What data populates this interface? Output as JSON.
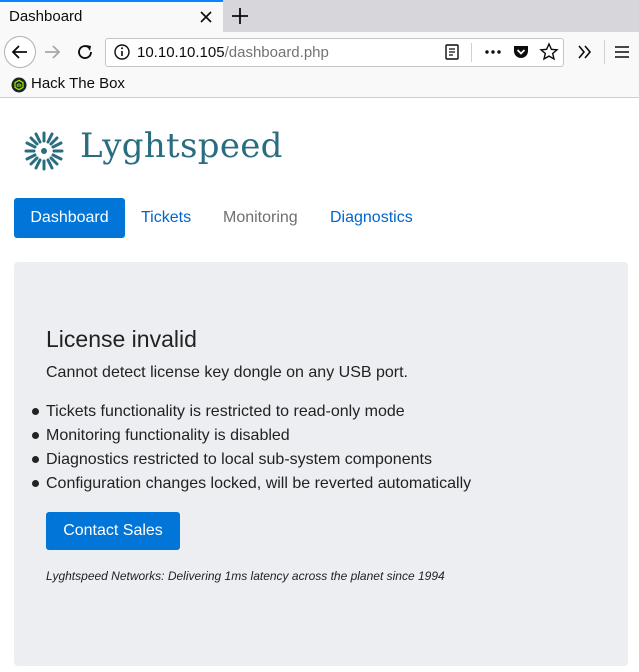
{
  "browser": {
    "tab_title": "Dashboard",
    "url_host": "10.10.10.105",
    "url_path": "/dashboard.php",
    "bookmark_label": "Hack The Box"
  },
  "site": {
    "brand": "Lyghtspeed",
    "nav": [
      {
        "label": "Dashboard",
        "active": true
      },
      {
        "label": "Tickets"
      },
      {
        "label": "Monitoring"
      },
      {
        "label": "Diagnostics"
      }
    ]
  },
  "notice": {
    "title": "License invalid",
    "lead": "Cannot detect license key dongle on any USB port.",
    "items": [
      "Tickets functionality is restricted to read-only mode",
      "Monitoring functionality is disabled",
      "Diagnostics restricted to local sub-system components",
      "Configuration changes locked, will be reverted automatically"
    ],
    "button": "Contact Sales",
    "footer": "Lyghtspeed Networks: Delivering 1ms latency across the planet since 1994"
  },
  "colors": {
    "accent": "#0275d8",
    "brand": "#2a6d80",
    "panel": "#eceef1"
  },
  "icons": [
    "close-icon",
    "plus-icon",
    "back-arrow-icon",
    "forward-arrow-icon",
    "reload-icon",
    "info-icon",
    "reader-view-icon",
    "more-icon",
    "pocket-icon",
    "star-icon",
    "overflow-icon",
    "menu-icon",
    "htb-logo-icon",
    "lyghtspeed-logo-icon"
  ]
}
